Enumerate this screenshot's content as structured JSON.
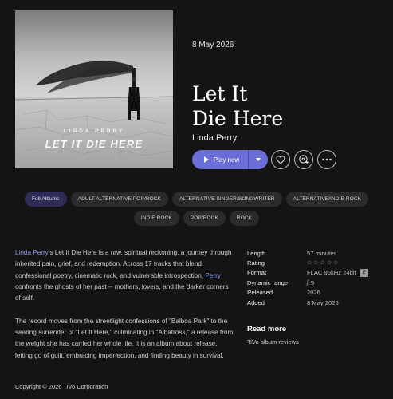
{
  "album": {
    "release_date": "8 May 2026",
    "title_line1": "Let It",
    "title_line2": "Die Here",
    "artist": "Linda Perry",
    "cover_artist_text": "LINDA PERRY",
    "cover_title_text": "LET IT DIE HERE"
  },
  "actions": {
    "play_label": "Play now",
    "play_icon": "play-icon",
    "more_options_icon": "chevron-down-icon",
    "favorite_icon": "heart-icon",
    "add_icon": "add-to-library-icon",
    "menu_icon": "ellipsis-icon"
  },
  "tags_row1": [
    "Full Albums",
    "ADULT ALTERNATIVE POP/ROCK",
    "ALTERNATIVE SINGER/SONGWRITER",
    "ALTERNATIVE/INDIE ROCK"
  ],
  "tags_row2": [
    "INDIE ROCK",
    "POP/ROCK",
    "ROCK"
  ],
  "description": {
    "p1_link1": "Linda Perry",
    "p1_text1": "'s Let It Die Here is a raw, spiritual reckoning, a journey through inherited pain, grief, and redemption. Across 17 tracks that blend confessional poetry, cinematic rock, and vulnerable introspection, ",
    "p1_link2": "Perry",
    "p1_text2": " confronts the ghosts of her past -- mothers, lovers, and the darker corners of self.",
    "p2": "The record moves from the streetlight confessions of \"Balboa Park\" to the searing surrender of \"Let It Here,\" culminating in \"Albatross,\" a release from the weight she has carried her whole life. It is an album about release, letting go of guilt, embracing imperfection, and finding beauty in survival."
  },
  "details": {
    "length_label": "Length",
    "length_value": "57 minutes",
    "rating_label": "Rating",
    "rating_value": 0,
    "rating_max": 5,
    "format_label": "Format",
    "format_value": "FLAC 96kHz 24bit",
    "format_badge": "E",
    "dynamic_label": "Dynamic range",
    "dynamic_value": "9",
    "released_label": "Released",
    "released_value": "2026",
    "added_label": "Added",
    "added_value": "8 May 2026"
  },
  "review": {
    "read_more": "Read more",
    "source": "TiVo album reviews"
  },
  "footer": {
    "copyright": "Copyright © 2026 TiVo Corporation"
  },
  "colors": {
    "background": "#141414",
    "accent": "#6b6ed6",
    "link": "#8e8ff0",
    "tag_bg": "#2b2b2b",
    "tag_active_bg": "#2f2d57"
  }
}
